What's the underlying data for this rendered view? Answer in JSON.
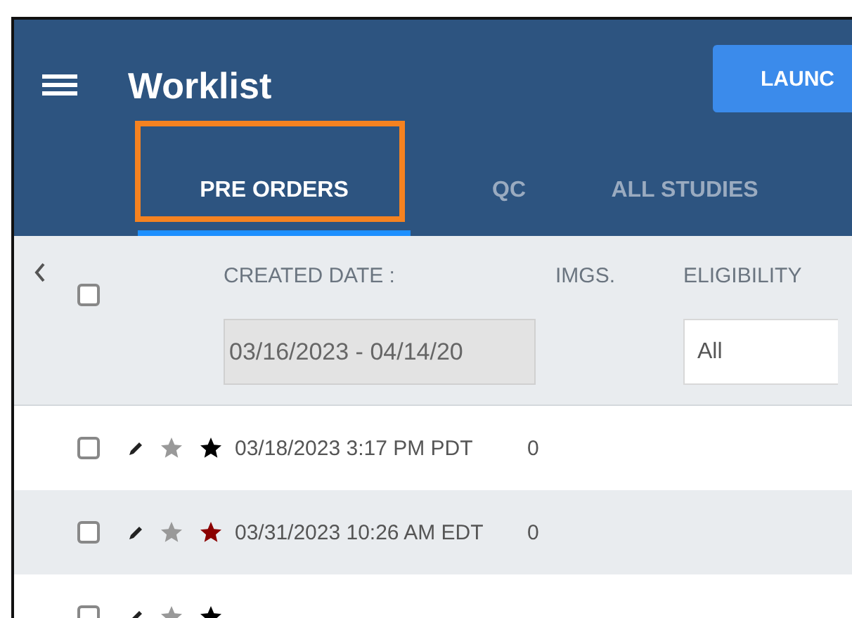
{
  "header": {
    "title": "Worklist",
    "launch_button": "LAUNC"
  },
  "tabs": [
    {
      "label": "PRE ORDERS",
      "selected": true,
      "highlighted": true
    },
    {
      "label": "QC",
      "selected": false,
      "highlighted": false
    },
    {
      "label": "ALL STUDIES",
      "selected": false,
      "highlighted": false
    }
  ],
  "filters": {
    "select_all_checked": false,
    "columns": [
      {
        "kind": "date",
        "label": "CREATED DATE :",
        "value": "03/16/2023 - 04/14/20"
      },
      {
        "kind": "none",
        "label": "IMGS."
      },
      {
        "kind": "select",
        "label": "ELIGIBILITY",
        "value": "All"
      }
    ]
  },
  "rows": [
    {
      "checked": false,
      "color": "#000000",
      "created": "03/18/2023 3:17 PM PDT",
      "imgs": "0"
    },
    {
      "checked": false,
      "color": "#8b0000",
      "created": "03/31/2023 10:26 AM EDT",
      "imgs": "0"
    },
    {
      "checked": false,
      "color": "#000000"
    }
  ]
}
